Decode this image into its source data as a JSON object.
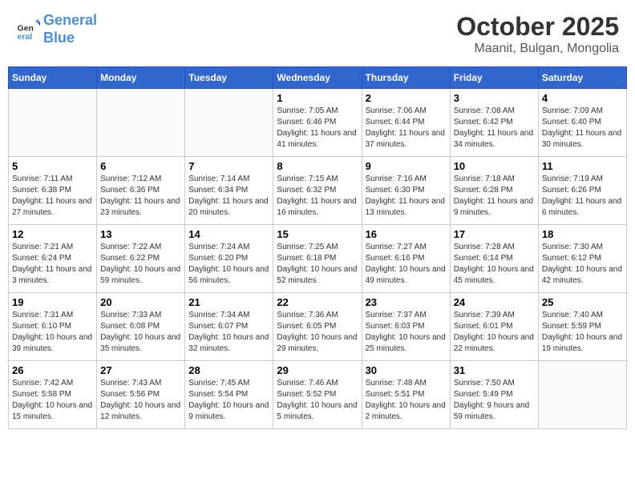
{
  "header": {
    "logo_line1": "General",
    "logo_line2": "Blue",
    "month": "October 2025",
    "location": "Maanit, Bulgan, Mongolia"
  },
  "weekdays": [
    "Sunday",
    "Monday",
    "Tuesday",
    "Wednesday",
    "Thursday",
    "Friday",
    "Saturday"
  ],
  "weeks": [
    [
      {
        "day": "",
        "info": ""
      },
      {
        "day": "",
        "info": ""
      },
      {
        "day": "",
        "info": ""
      },
      {
        "day": "1",
        "info": "Sunrise: 7:05 AM\nSunset: 6:46 PM\nDaylight: 11 hours and 41 minutes."
      },
      {
        "day": "2",
        "info": "Sunrise: 7:06 AM\nSunset: 6:44 PM\nDaylight: 11 hours and 37 minutes."
      },
      {
        "day": "3",
        "info": "Sunrise: 7:08 AM\nSunset: 6:42 PM\nDaylight: 11 hours and 34 minutes."
      },
      {
        "day": "4",
        "info": "Sunrise: 7:09 AM\nSunset: 6:40 PM\nDaylight: 11 hours and 30 minutes."
      }
    ],
    [
      {
        "day": "5",
        "info": "Sunrise: 7:11 AM\nSunset: 6:38 PM\nDaylight: 11 hours and 27 minutes."
      },
      {
        "day": "6",
        "info": "Sunrise: 7:12 AM\nSunset: 6:36 PM\nDaylight: 11 hours and 23 minutes."
      },
      {
        "day": "7",
        "info": "Sunrise: 7:14 AM\nSunset: 6:34 PM\nDaylight: 11 hours and 20 minutes."
      },
      {
        "day": "8",
        "info": "Sunrise: 7:15 AM\nSunset: 6:32 PM\nDaylight: 11 hours and 16 minutes."
      },
      {
        "day": "9",
        "info": "Sunrise: 7:16 AM\nSunset: 6:30 PM\nDaylight: 11 hours and 13 minutes."
      },
      {
        "day": "10",
        "info": "Sunrise: 7:18 AM\nSunset: 6:28 PM\nDaylight: 11 hours and 9 minutes."
      },
      {
        "day": "11",
        "info": "Sunrise: 7:19 AM\nSunset: 6:26 PM\nDaylight: 11 hours and 6 minutes."
      }
    ],
    [
      {
        "day": "12",
        "info": "Sunrise: 7:21 AM\nSunset: 6:24 PM\nDaylight: 11 hours and 3 minutes."
      },
      {
        "day": "13",
        "info": "Sunrise: 7:22 AM\nSunset: 6:22 PM\nDaylight: 10 hours and 59 minutes."
      },
      {
        "day": "14",
        "info": "Sunrise: 7:24 AM\nSunset: 6:20 PM\nDaylight: 10 hours and 56 minutes."
      },
      {
        "day": "15",
        "info": "Sunrise: 7:25 AM\nSunset: 6:18 PM\nDaylight: 10 hours and 52 minutes."
      },
      {
        "day": "16",
        "info": "Sunrise: 7:27 AM\nSunset: 6:16 PM\nDaylight: 10 hours and 49 minutes."
      },
      {
        "day": "17",
        "info": "Sunrise: 7:28 AM\nSunset: 6:14 PM\nDaylight: 10 hours and 45 minutes."
      },
      {
        "day": "18",
        "info": "Sunrise: 7:30 AM\nSunset: 6:12 PM\nDaylight: 10 hours and 42 minutes."
      }
    ],
    [
      {
        "day": "19",
        "info": "Sunrise: 7:31 AM\nSunset: 6:10 PM\nDaylight: 10 hours and 39 minutes."
      },
      {
        "day": "20",
        "info": "Sunrise: 7:33 AM\nSunset: 6:08 PM\nDaylight: 10 hours and 35 minutes."
      },
      {
        "day": "21",
        "info": "Sunrise: 7:34 AM\nSunset: 6:07 PM\nDaylight: 10 hours and 32 minutes."
      },
      {
        "day": "22",
        "info": "Sunrise: 7:36 AM\nSunset: 6:05 PM\nDaylight: 10 hours and 29 minutes."
      },
      {
        "day": "23",
        "info": "Sunrise: 7:37 AM\nSunset: 6:03 PM\nDaylight: 10 hours and 25 minutes."
      },
      {
        "day": "24",
        "info": "Sunrise: 7:39 AM\nSunset: 6:01 PM\nDaylight: 10 hours and 22 minutes."
      },
      {
        "day": "25",
        "info": "Sunrise: 7:40 AM\nSunset: 5:59 PM\nDaylight: 10 hours and 19 minutes."
      }
    ],
    [
      {
        "day": "26",
        "info": "Sunrise: 7:42 AM\nSunset: 5:58 PM\nDaylight: 10 hours and 15 minutes."
      },
      {
        "day": "27",
        "info": "Sunrise: 7:43 AM\nSunset: 5:56 PM\nDaylight: 10 hours and 12 minutes."
      },
      {
        "day": "28",
        "info": "Sunrise: 7:45 AM\nSunset: 5:54 PM\nDaylight: 10 hours and 9 minutes."
      },
      {
        "day": "29",
        "info": "Sunrise: 7:46 AM\nSunset: 5:52 PM\nDaylight: 10 hours and 5 minutes."
      },
      {
        "day": "30",
        "info": "Sunrise: 7:48 AM\nSunset: 5:51 PM\nDaylight: 10 hours and 2 minutes."
      },
      {
        "day": "31",
        "info": "Sunrise: 7:50 AM\nSunset: 5:49 PM\nDaylight: 9 hours and 59 minutes."
      },
      {
        "day": "",
        "info": ""
      }
    ]
  ]
}
